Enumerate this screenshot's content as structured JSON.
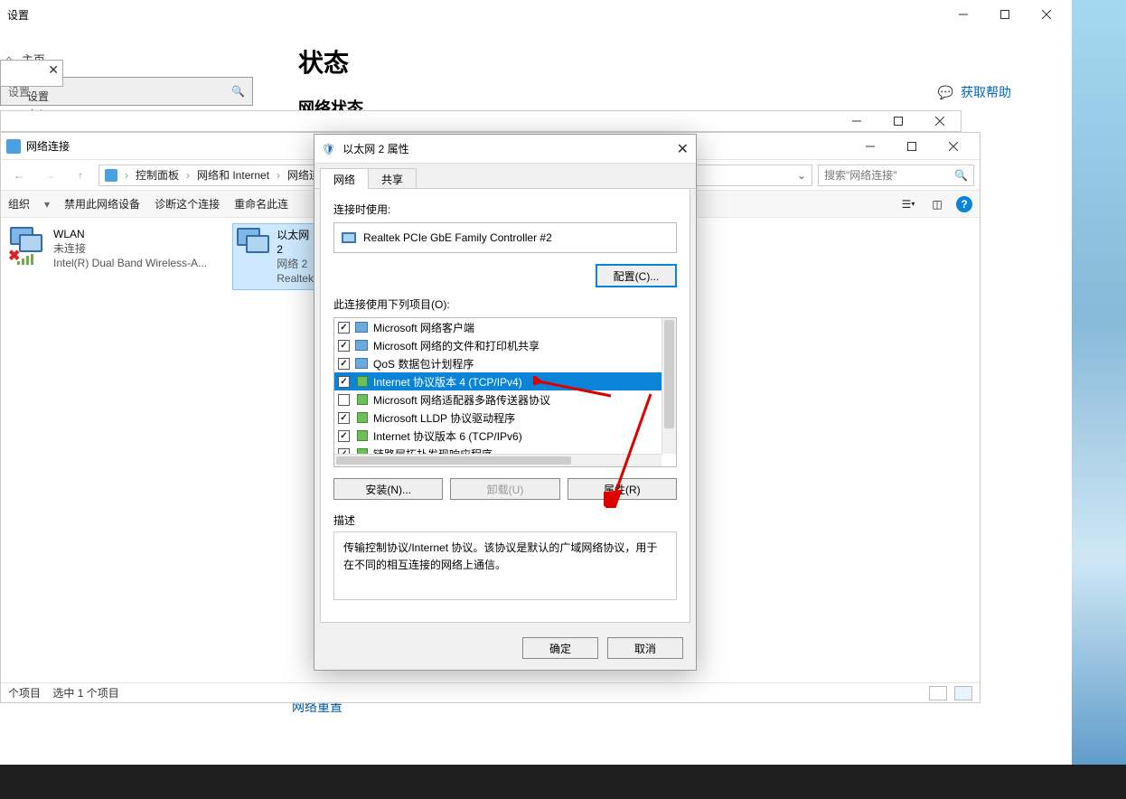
{
  "settings": {
    "title": "设置",
    "home": "主页",
    "search_placeholder": "设置",
    "section_label": "中心",
    "main_heading": "状态",
    "sub_heading": "网络状态",
    "help_link": "获取帮助",
    "net_reset": "网络重置"
  },
  "netconn": {
    "title": "网络连接",
    "breadcrumb": {
      "seg1": "控制面板",
      "seg2": "网络和 Internet",
      "seg3": "网络连"
    },
    "search_placeholder": "搜索\"网络连接\"",
    "toolbar": {
      "org": "组织",
      "disable": "禁用此网络设备",
      "diagnose": "诊断这个连接",
      "rename": "重命名此连"
    },
    "items": [
      {
        "l1": "WLAN",
        "l2": "未连接",
        "l3": "Intel(R) Dual Band Wireless-A..."
      },
      {
        "l1": "以太网 2",
        "l2": "网络 2",
        "l3": "Realtek"
      }
    ],
    "status_left": "个项目",
    "status_sel": "选中 1 个项目"
  },
  "props": {
    "title": "以太网 2 属性",
    "tabs": {
      "net": "网络",
      "share": "共享"
    },
    "connect_label": "连接时使用:",
    "adapter": "Realtek PCIe GbE Family Controller #2",
    "configure_btn": "配置(C)...",
    "list_label": "此连接使用下列项目(O):",
    "list": [
      {
        "chk": true,
        "txt": "Microsoft 网络客户端",
        "type": "svc"
      },
      {
        "chk": true,
        "txt": "Microsoft 网络的文件和打印机共享",
        "type": "svc"
      },
      {
        "chk": true,
        "txt": "QoS 数据包计划程序",
        "type": "svc"
      },
      {
        "chk": true,
        "txt": "Internet 协议版本 4 (TCP/IPv4)",
        "type": "proto",
        "sel": true
      },
      {
        "chk": false,
        "txt": "Microsoft 网络适配器多路传送器协议",
        "type": "proto"
      },
      {
        "chk": true,
        "txt": "Microsoft LLDP 协议驱动程序",
        "type": "proto"
      },
      {
        "chk": true,
        "txt": "Internet 协议版本 6 (TCP/IPv6)",
        "type": "proto"
      },
      {
        "chk": true,
        "txt": "链路层拓扑发现响应程序",
        "type": "proto"
      }
    ],
    "install_btn": "安装(N)...",
    "uninstall_btn": "卸载(U)",
    "property_btn": "属性(R)",
    "desc_label": "描述",
    "desc_text": "传输控制协议/Internet 协议。该协议是默认的广域网络协议，用于在不同的相互连接的网络上通信。",
    "ok_btn": "确定",
    "cancel_btn": "取消"
  }
}
